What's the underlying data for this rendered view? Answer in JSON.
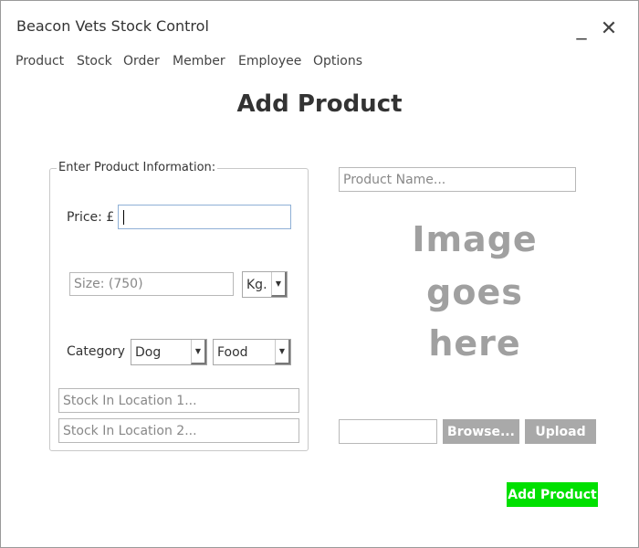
{
  "window": {
    "title": "Beacon Vets Stock Control",
    "minimize_glyph": "_",
    "close_glyph": "✕"
  },
  "menu": {
    "items": [
      "Product",
      "Stock",
      "Order",
      "Member",
      "Employee",
      "Options"
    ]
  },
  "page": {
    "heading": "Add Product"
  },
  "form": {
    "group_label": "Enter Product Information:",
    "price_label": "Price: £",
    "price_value": "",
    "size_placeholder": "Size: (750)",
    "unit_selected": "Kg.",
    "category_label": "Category",
    "category_selected": "Dog",
    "type_selected": "Food",
    "stock_location_1_placeholder": "Stock In Location 1...",
    "stock_location_2_placeholder": "Stock In Location 2..."
  },
  "product": {
    "name_placeholder": "Product Name...",
    "image_placeholder_lines": [
      "Image",
      "goes",
      "here"
    ],
    "file_path_value": "",
    "browse_label": "Browse...",
    "upload_label": "Upload",
    "add_product_label": "Add Product"
  },
  "colors": {
    "accent_green": "#00e000",
    "button_gray": "#a9a9a9",
    "placeholder_gray": "#a0a0a0"
  }
}
